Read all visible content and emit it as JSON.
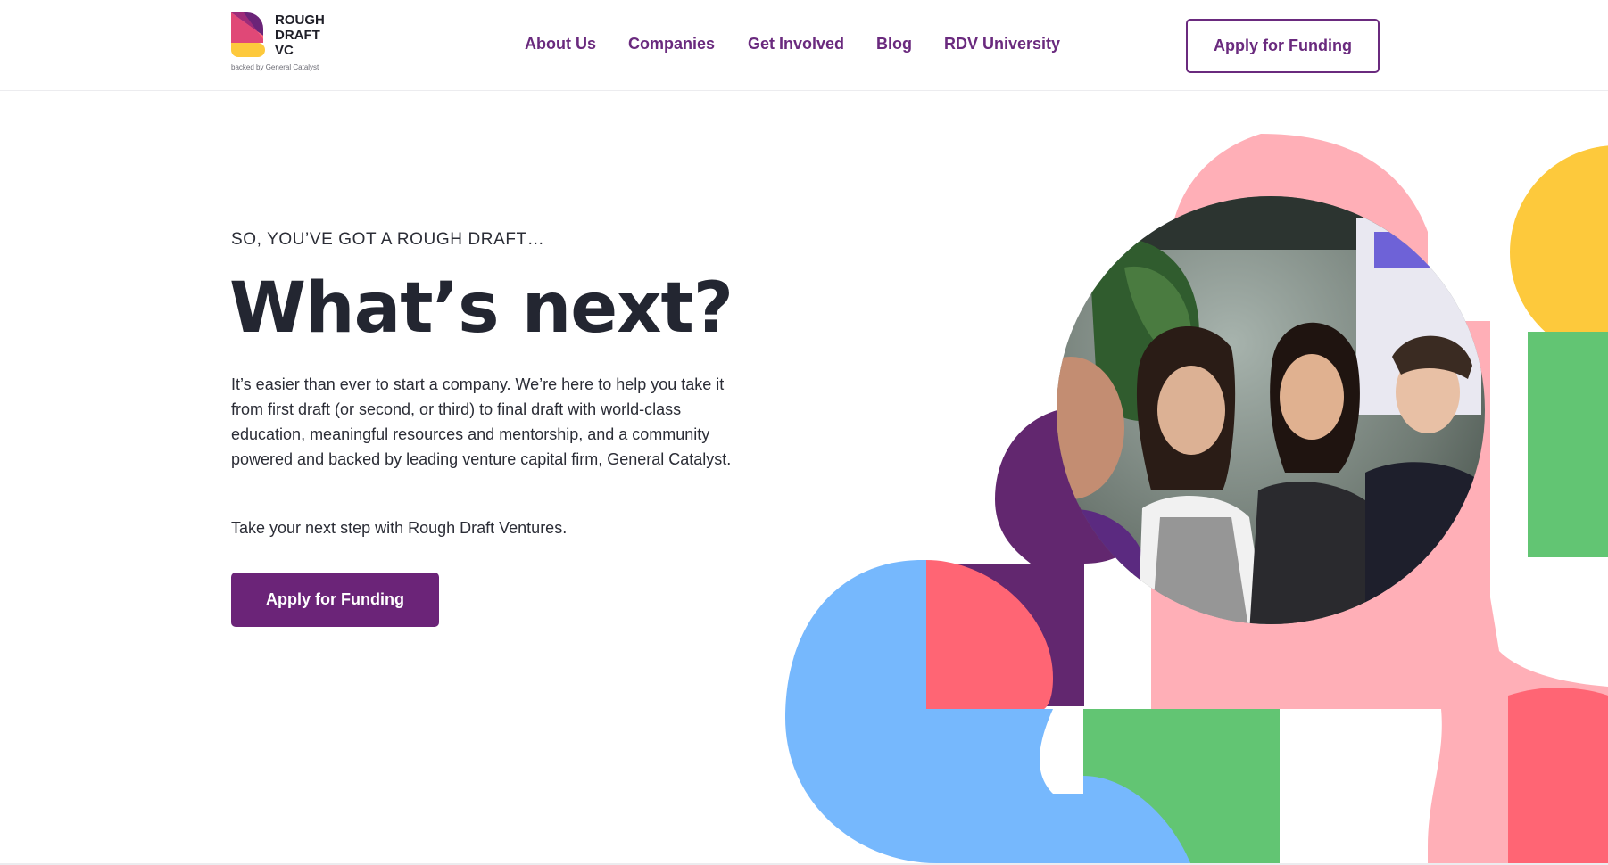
{
  "brand": {
    "logo_lines": [
      "ROUGH",
      "DRAFT",
      "VC"
    ],
    "tagline": "backed by General Catalyst"
  },
  "nav": {
    "items": [
      {
        "label": "About Us"
      },
      {
        "label": "Companies"
      },
      {
        "label": "Get Involved"
      },
      {
        "label": "Blog"
      },
      {
        "label": "RDV University"
      }
    ],
    "cta_label": "Apply for Funding"
  },
  "hero": {
    "eyebrow": "SO, YOU’VE GOT A ROUGH DRAFT…",
    "headline": "What’s next?",
    "body": "It’s easier than ever to start a company. We’re here to help you take it from first draft (or second, or third) to final draft with world-class education, meaningful resources and mentorship, and a community powered and backed by leading venture capital firm, General Catalyst.",
    "body2": "Take your next step with Rough Draft Ventures.",
    "cta_label": "Apply for Funding"
  },
  "colors": {
    "brand_purple": "#6b2478",
    "deep_purple": "#62276f",
    "blue": "#76b8fd",
    "coral": "#ff6574",
    "pink": "#ffafb7",
    "green": "#62c573",
    "yellow": "#fdc93c"
  }
}
